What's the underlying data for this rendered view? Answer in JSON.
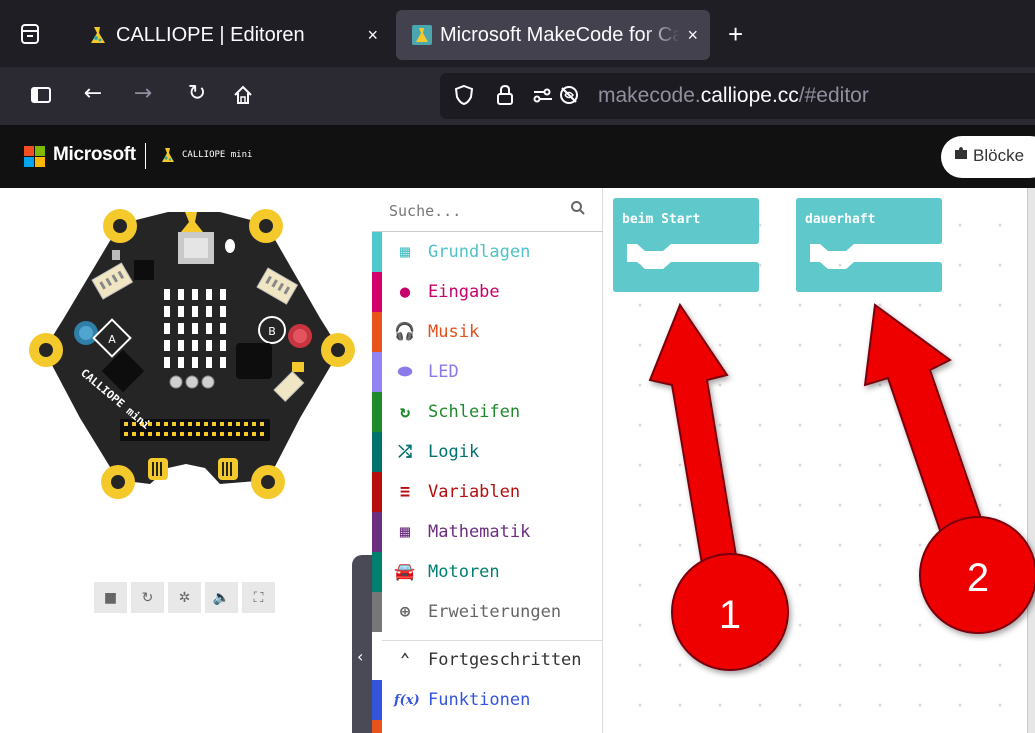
{
  "browser": {
    "tabs": [
      {
        "title": "CALLIOPE | Editoren",
        "active": false
      },
      {
        "title": "Microsoft MakeCode for Calliope mini",
        "active": true
      }
    ],
    "close_glyph": "×",
    "new_tab_glyph": "+",
    "url_prefix": "makecode.",
    "url_domain": "calliope.cc",
    "url_path": "/#editor"
  },
  "header": {
    "microsoft_label": "Microsoft",
    "product_label": "CALLIOPE mini",
    "blocks_toggle_label": "Blöcke"
  },
  "simulator": {
    "button_a": "A",
    "button_b": "B",
    "board_name": "CALLIOPE mini",
    "controls": [
      {
        "name": "stop-icon",
        "glyph": "■"
      },
      {
        "name": "restart-icon",
        "glyph": "↻"
      },
      {
        "name": "debug-icon",
        "glyph": "✲"
      },
      {
        "name": "sound-icon",
        "glyph": "🔈"
      },
      {
        "name": "fullscreen-icon",
        "glyph": "⛶"
      }
    ]
  },
  "toolbox": {
    "search_placeholder": "Suche...",
    "categories": [
      {
        "label": "Grundlagen",
        "color": "#1e90ff",
        "bar": "#4dc8cc",
        "text_color": "#4ec2c7",
        "icon": "▦"
      },
      {
        "label": "Eingabe",
        "color": "#d400d4",
        "bar": "#d1006b",
        "text_color": "#c7006a",
        "icon": "●"
      },
      {
        "label": "Musik",
        "color": "#e63022",
        "bar": "#e8521c",
        "text_color": "#e0511c",
        "icon": "🎧"
      },
      {
        "label": "LED",
        "color": "#5c2d91",
        "bar": "#9184f2",
        "text_color": "#8a7be8",
        "icon": "⬬"
      },
      {
        "label": "Schleifen",
        "color": "#00aa00",
        "bar": "#1e8a2c",
        "text_color": "#1e8a2c",
        "icon": "↻"
      },
      {
        "label": "Logik",
        "color": "#00a4a6",
        "bar": "#00716d",
        "text_color": "#00716d",
        "icon": "⤮"
      },
      {
        "label": "Variablen",
        "color": "#dc143c",
        "bar": "#b70d0d",
        "text_color": "#b70d0d",
        "icon": "≡"
      },
      {
        "label": "Mathematik",
        "color": "#9400d3",
        "bar": "#6c2f80",
        "text_color": "#6c2f80",
        "icon": "▦"
      },
      {
        "label": "Motoren",
        "color": "#00a4a6",
        "bar": "#00806f",
        "text_color": "#00806f",
        "icon": "🚘"
      },
      {
        "label": "Erweiterungen",
        "color": "#777777",
        "bar": "#777777",
        "text_color": "#666666",
        "icon": "⊕"
      }
    ],
    "advanced_label": "Fortgeschritten",
    "advanced_icon": "⌃",
    "functions_label": "Funktionen",
    "functions_icon": "f(x)",
    "functions_color": "#3455db"
  },
  "workspace": {
    "blocks": [
      {
        "label": "beim Start",
        "color": "#5ec8ca"
      },
      {
        "label": "dauerhaft",
        "color": "#5ec8ca"
      }
    ],
    "annotations": [
      {
        "label": "1"
      },
      {
        "label": "2"
      }
    ]
  },
  "colors": {
    "annotation_red": "#ee0000",
    "hex_board": "#242424",
    "pad_gold": "#f4c92c"
  }
}
